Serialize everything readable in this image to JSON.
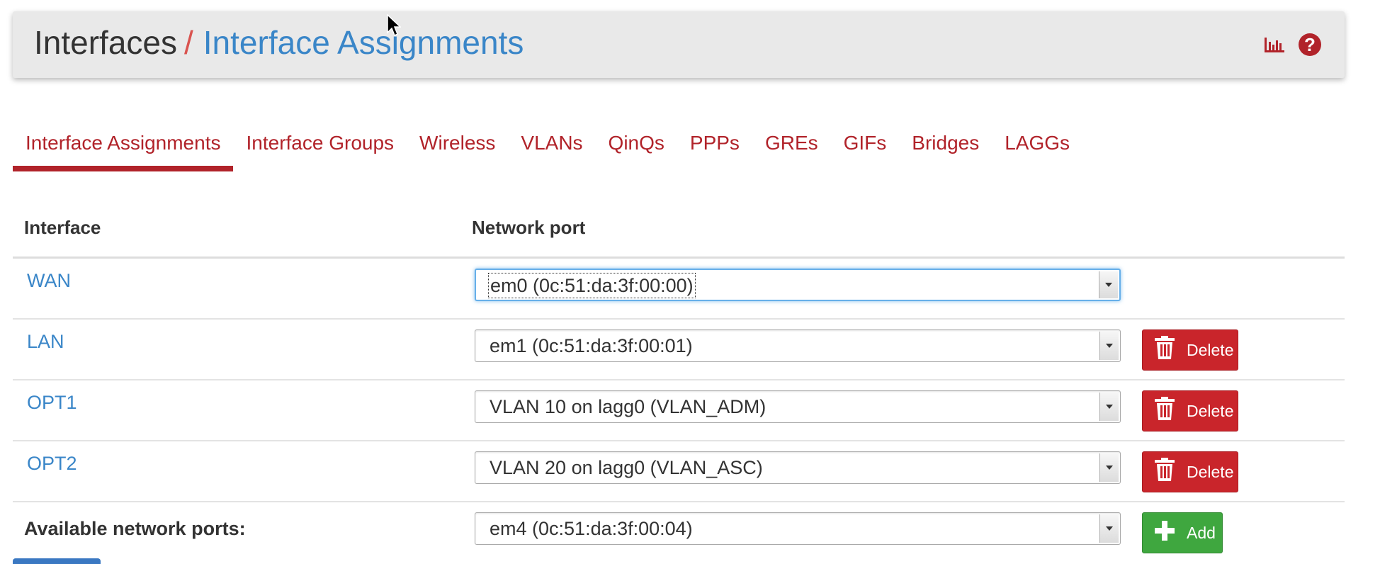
{
  "breadcrumb": {
    "root": "Interfaces",
    "separator": "/",
    "current": "Interface Assignments"
  },
  "header_icons": [
    "bar-chart-icon",
    "help-icon"
  ],
  "tabs": [
    {
      "label": "Interface Assignments",
      "active": true
    },
    {
      "label": "Interface Groups",
      "active": false
    },
    {
      "label": "Wireless",
      "active": false
    },
    {
      "label": "VLANs",
      "active": false
    },
    {
      "label": "QinQs",
      "active": false
    },
    {
      "label": "PPPs",
      "active": false
    },
    {
      "label": "GREs",
      "active": false
    },
    {
      "label": "GIFs",
      "active": false
    },
    {
      "label": "Bridges",
      "active": false
    },
    {
      "label": "LAGGs",
      "active": false
    }
  ],
  "table": {
    "headers": {
      "interface": "Interface",
      "network_port": "Network port"
    },
    "rows": [
      {
        "interface": "WAN",
        "port": "em0 (0c:51:da:3f:00:00)",
        "focused": true,
        "delete_label": ""
      },
      {
        "interface": "LAN",
        "port": "em1 (0c:51:da:3f:00:01)",
        "focused": false,
        "delete_label": "Delete"
      },
      {
        "interface": "OPT1",
        "port": "VLAN 10 on lagg0 (VLAN_ADM)",
        "focused": false,
        "delete_label": "Delete"
      },
      {
        "interface": "OPT2",
        "port": "VLAN 20 on lagg0 (VLAN_ASC)",
        "focused": false,
        "delete_label": "Delete"
      }
    ],
    "available": {
      "label": "Available network ports:",
      "port": "em4 (0c:51:da:3f:00:04)",
      "add_label": "Add"
    }
  },
  "colors": {
    "accent_red": "#b1232a",
    "link_blue": "#3a86c8",
    "delete_red": "#c9252b",
    "add_green": "#3fa73f"
  }
}
